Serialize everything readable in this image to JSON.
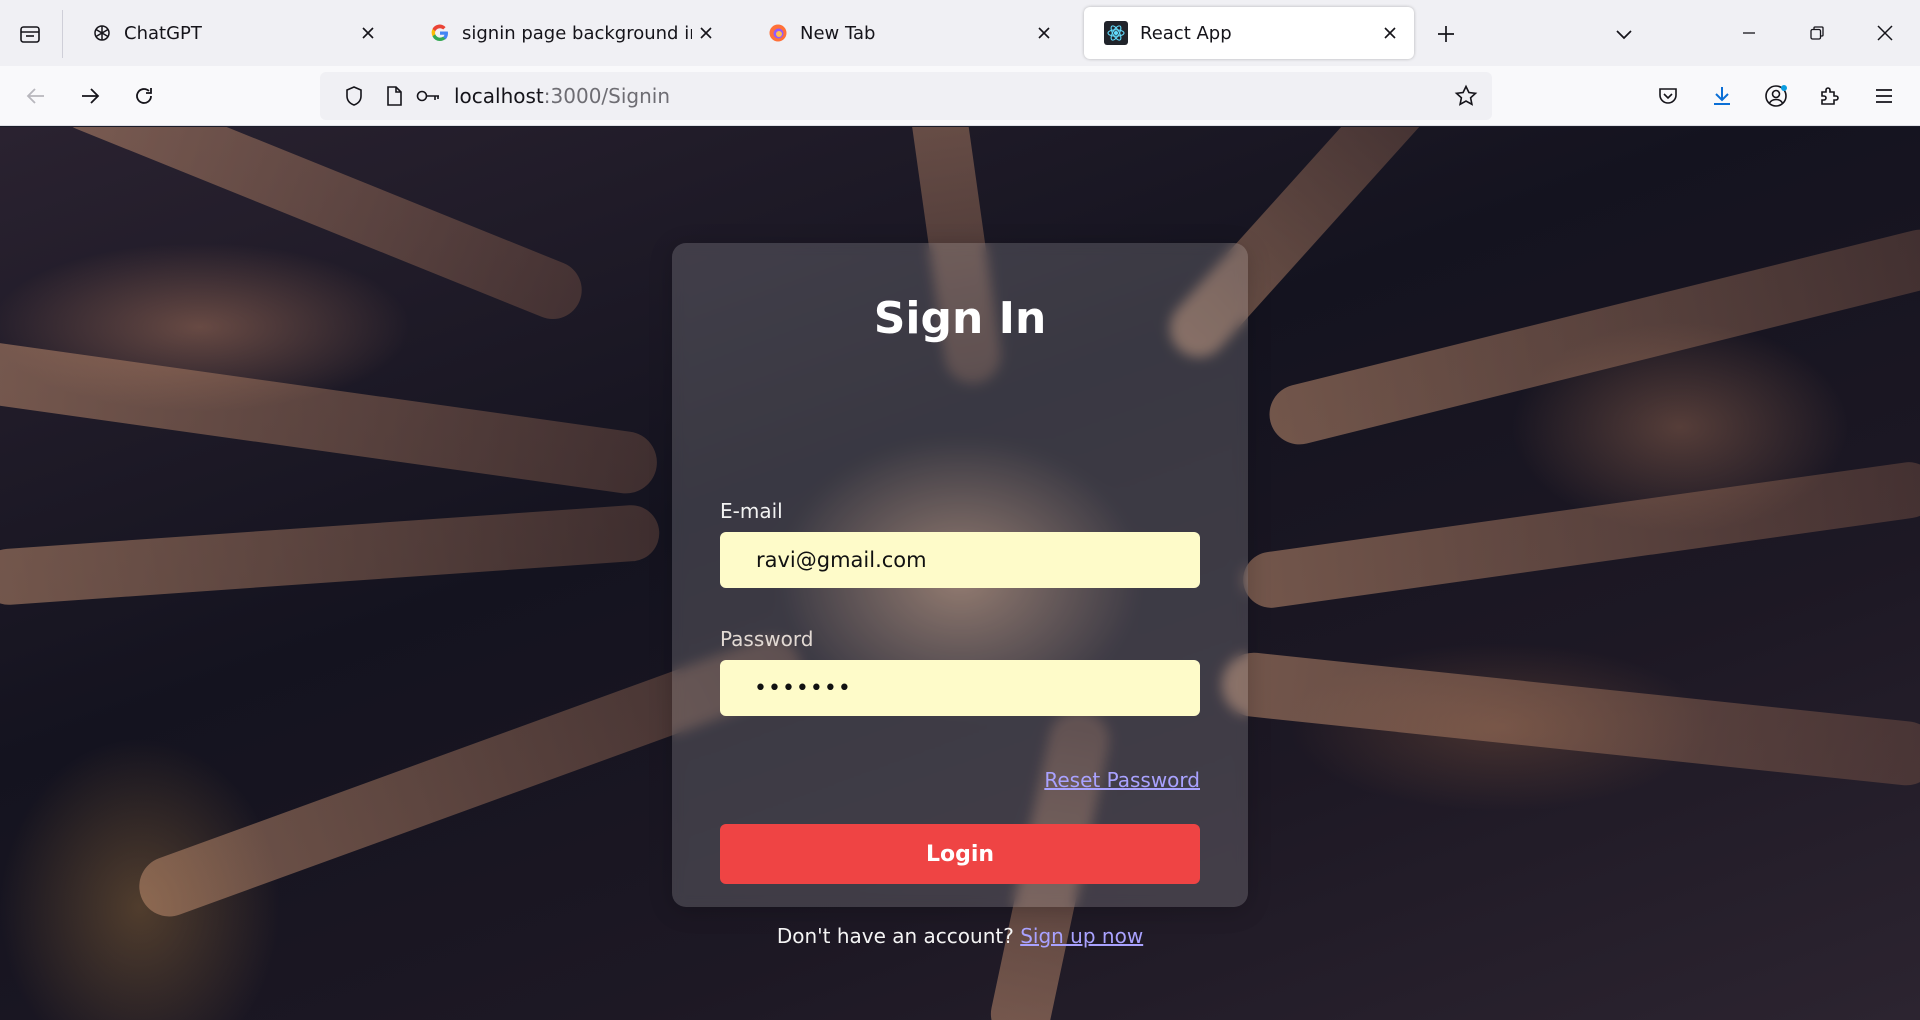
{
  "browser": {
    "tabs": [
      {
        "title": "ChatGPT",
        "icon": "chatgpt-icon",
        "active": false
      },
      {
        "title": "signin page background image",
        "icon": "google-icon",
        "active": false
      },
      {
        "title": "New Tab",
        "icon": "firefox-icon",
        "active": false
      },
      {
        "title": "React App",
        "icon": "react-icon",
        "active": true
      }
    ],
    "url_host": "localhost",
    "url_path": ":3000/Signin"
  },
  "signin": {
    "title": "Sign In",
    "email_label": "E-mail",
    "email_value": "ravi@gmail.com",
    "password_label": "Password",
    "password_value": "•••••••",
    "reset_link": "Reset Password",
    "login_button": "Login",
    "signup_prompt": "Don't have an account?",
    "signup_link": "Sign up now"
  },
  "colors": {
    "login_button": "#ef4444",
    "input_background": "#fefbc9",
    "link": "#a9a2ff"
  }
}
